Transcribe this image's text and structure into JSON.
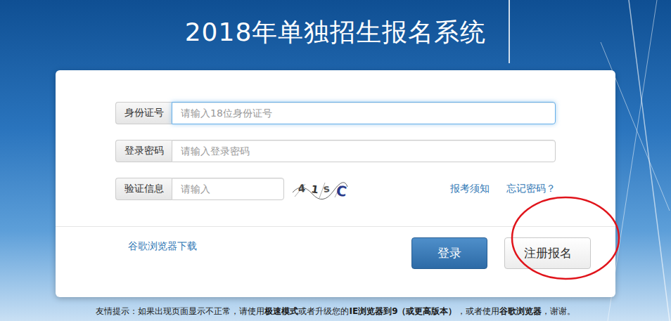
{
  "title": "2018年单独招生报名系统",
  "fields": [
    {
      "label": "身份证号",
      "placeholder": "请输入18位身份证号",
      "focused": true,
      "kind": "text"
    },
    {
      "label": "登录密码",
      "placeholder": "请输入登录密码",
      "focused": false,
      "kind": "password"
    },
    {
      "label": "验证信息",
      "placeholder": "请输入",
      "focused": false,
      "kind": "captcha"
    }
  ],
  "captcha": "41sC",
  "links": [
    "报考须知",
    "忘记密码？"
  ],
  "download_link": "谷歌浏览器下载",
  "buttons": [
    {
      "label": "登录",
      "kind": "primary",
      "highlighted": false
    },
    {
      "label": "注册报名",
      "kind": "default",
      "highlighted": true
    }
  ],
  "footer": [
    {
      "text": "友情提示：如果出现页面显示不正常，请使用",
      "bold": false
    },
    {
      "text": "极速模式",
      "bold": true
    },
    {
      "text": "或者升级您的",
      "bold": false
    },
    {
      "text": "IE浏览器到9（或更高版本）",
      "bold": true
    },
    {
      "text": "，或者使用",
      "bold": false
    },
    {
      "text": "谷歌浏览器",
      "bold": true
    },
    {
      "text": "，谢谢。",
      "bold": false
    }
  ]
}
